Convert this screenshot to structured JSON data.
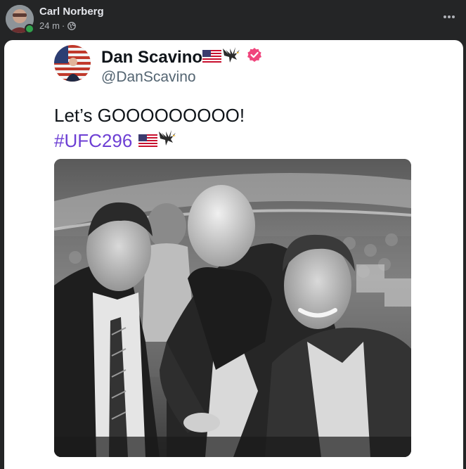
{
  "post": {
    "author": "Carl Norberg",
    "time": "24 m",
    "separator": "·",
    "audience_icon": "globe-icon",
    "more_icon": "more-options-icon"
  },
  "tweet": {
    "name": "Dan Scavino",
    "handle": "@DanScavino",
    "text": "Let’s GOOOOOOOOO!",
    "hashtag": "#UFC296",
    "verified_color": "#f0447c",
    "hashtag_color": "#6d3fd4"
  },
  "colors": {
    "background": "#242526",
    "card": "#ffffff",
    "online": "#31a24c"
  }
}
